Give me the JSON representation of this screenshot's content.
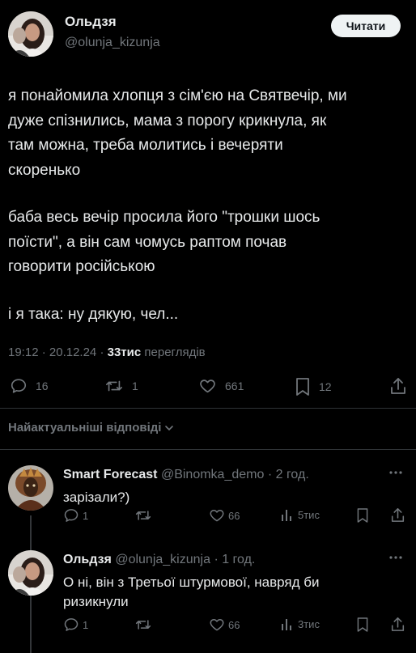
{
  "author": {
    "name": "Ольдзя",
    "handle": "@olunja_kizunja",
    "follow_label": "Читати"
  },
  "post": {
    "paragraphs": [
      "я понайомила хлопця з сім'єю на Святвечір, ми\nдуже спізнились, мама з порогу крикнула, як\nтам можна, треба молитись і вечеряти\nскоренько",
      "баба весь вечір просила його \"трошки шось\nпоїсти\", а він сам чомусь раптом почав\nговорити російською",
      "і я така: ну дякую, чел..."
    ],
    "time": "19:12",
    "date": "20.12.24",
    "separator": "·",
    "views_count": "33тис",
    "views_label": "переглядів"
  },
  "actions": {
    "replies": "16",
    "reposts": "1",
    "likes": "661",
    "bookmarks": "12"
  },
  "replies_section": {
    "sort_label": "Найактуальніші відповіді"
  },
  "replies": [
    {
      "name": "Smart Forecast",
      "handle": "@Binomka_demo",
      "time": "· 2 год.",
      "text": "зарізали?)",
      "replies": "1",
      "reposts": "",
      "likes": "66",
      "views": "5тис"
    },
    {
      "name": "Ольдзя",
      "handle": "@olunja_kizunja",
      "time": "· 1 год.",
      "text": "О ні, він з Третьої штурмової, навряд би\nризикнули",
      "replies": "1",
      "reposts": "",
      "likes": "66",
      "views": "3тис"
    }
  ],
  "colors": {
    "background": "#000000",
    "text": "#e7e9ea",
    "secondary": "#71767b",
    "divider": "#2f3336",
    "follow_bg": "#eff3f4"
  }
}
